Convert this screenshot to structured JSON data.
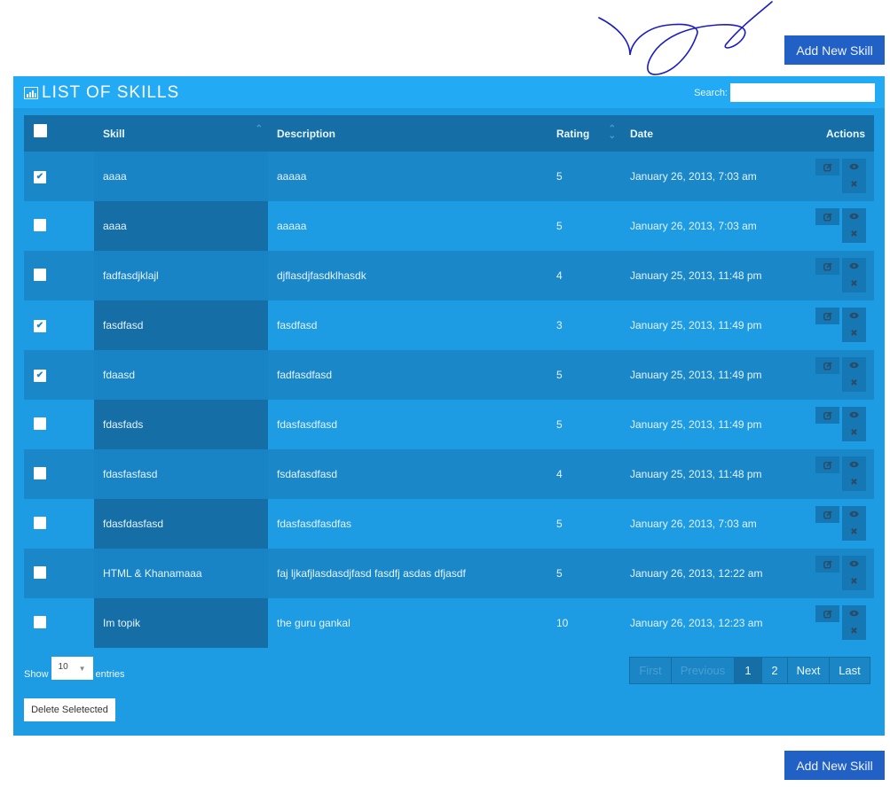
{
  "top_button": {
    "label": "Add New Skill"
  },
  "bottom_button": {
    "label": "Add New Skill"
  },
  "panel": {
    "title": "LIST OF SKILLS",
    "title_icon": "bar-chart-icon",
    "search": {
      "label": "Search:",
      "value": "",
      "placeholder": ""
    }
  },
  "table": {
    "columns": [
      {
        "key": "select",
        "label": "",
        "sort": "none"
      },
      {
        "key": "skill",
        "label": "Skill",
        "sort": "asc"
      },
      {
        "key": "description",
        "label": "Description",
        "sort": "none"
      },
      {
        "key": "rating",
        "label": "Rating",
        "sort": "both"
      },
      {
        "key": "date",
        "label": "Date",
        "sort": "none"
      },
      {
        "key": "actions",
        "label": "Actions",
        "sort": "none"
      }
    ],
    "header_checked": false,
    "rows": [
      {
        "checked": true,
        "skill": "aaaa",
        "description": "aaaaa",
        "rating": "5",
        "date": "January 26, 2013, 7:03 am"
      },
      {
        "checked": false,
        "skill": "aaaa",
        "description": "aaaaa",
        "rating": "5",
        "date": "January 26, 2013, 7:03 am"
      },
      {
        "checked": false,
        "skill": "fadfasdjklajl",
        "description": "djflasdjfasdklhasdk",
        "rating": "4",
        "date": "January 25, 2013, 11:48 pm"
      },
      {
        "checked": true,
        "skill": "fasdfasd",
        "description": "fasdfasd",
        "rating": "3",
        "date": "January 25, 2013, 11:49 pm"
      },
      {
        "checked": true,
        "skill": "fdaasd",
        "description": "fadfasdfasd",
        "rating": "5",
        "date": "January 25, 2013, 11:49 pm"
      },
      {
        "checked": false,
        "skill": "fdasfads",
        "description": "fdasfasdfasd",
        "rating": "5",
        "date": "January 25, 2013, 11:49 pm"
      },
      {
        "checked": false,
        "skill": "fdasfasfasd",
        "description": "fsdafasdfasd",
        "rating": "4",
        "date": "January 25, 2013, 11:48 pm"
      },
      {
        "checked": false,
        "skill": "fdasfdasfasd",
        "description": "fdasfasdfasdfas",
        "rating": "5",
        "date": "January 26, 2013, 7:03 am"
      },
      {
        "checked": false,
        "skill": "HTML & Khanamaaa",
        "description": "faj ljkafjlasdasdjfasd fasdfj asdas dfjasdf",
        "rating": "5",
        "date": "January 26, 2013, 12:22 am"
      },
      {
        "checked": false,
        "skill": "Im topik",
        "description": "the guru gankal",
        "rating": "10",
        "date": "January 26, 2013, 12:23 am"
      }
    ],
    "row_actions": [
      "edit-icon",
      "view-icon",
      "delete-icon"
    ]
  },
  "footer": {
    "show_label": "Show",
    "entries_label": "entries",
    "page_size": "10",
    "delete_label": "Delete Seletected",
    "pagination": [
      {
        "label": "First",
        "state": "disabled"
      },
      {
        "label": "Previous",
        "state": "disabled"
      },
      {
        "label": "1",
        "state": "active"
      },
      {
        "label": "2",
        "state": "normal"
      },
      {
        "label": "Next",
        "state": "normal"
      },
      {
        "label": "Last",
        "state": "normal"
      }
    ]
  },
  "colors": {
    "button_blue": "#2160c4",
    "panel_header": "#22aaf5",
    "panel_body": "#1d9be3",
    "table_header": "#156ea6",
    "scribble": "#1a1ac8"
  }
}
